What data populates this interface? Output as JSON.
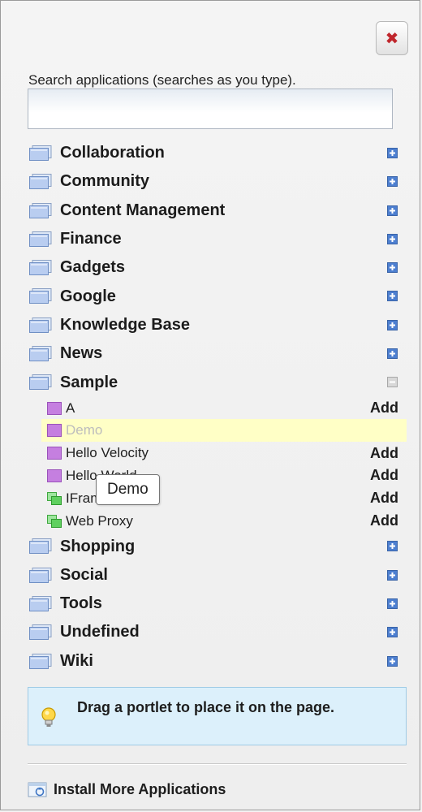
{
  "search": {
    "label": "Search applications (searches as you type).",
    "value": "",
    "placeholder": ""
  },
  "categories_top": [
    {
      "label": "Collaboration",
      "expanded": false
    },
    {
      "label": "Community",
      "expanded": false
    },
    {
      "label": "Content Management",
      "expanded": false
    },
    {
      "label": "Finance",
      "expanded": false
    },
    {
      "label": "Gadgets",
      "expanded": false
    },
    {
      "label": "Google",
      "expanded": false
    },
    {
      "label": "Knowledge Base",
      "expanded": false
    },
    {
      "label": "News",
      "expanded": false
    }
  ],
  "sample": {
    "label": "Sample",
    "expanded": true,
    "apps": [
      {
        "label": "A",
        "add": "Add",
        "icon": "portlet-icon-purple"
      },
      {
        "label": "Demo",
        "add": "",
        "icon": "portlet-icon-purple",
        "highlighted": true
      },
      {
        "label": "Hello Velocity",
        "add": "Add",
        "icon": "portlet-icon-purple"
      },
      {
        "label": "Hello World",
        "add": "Add",
        "icon": "portlet-icon-purple"
      },
      {
        "label": "IFrame",
        "add": "Add",
        "icon": "portlet-icon-green"
      },
      {
        "label": "Web Proxy",
        "add": "Add",
        "icon": "portlet-icon-green"
      }
    ]
  },
  "categories_bottom": [
    {
      "label": "Shopping",
      "expanded": false
    },
    {
      "label": "Social",
      "expanded": false
    },
    {
      "label": "Tools",
      "expanded": false
    },
    {
      "label": "Undefined",
      "expanded": false
    },
    {
      "label": "Wiki",
      "expanded": false
    }
  ],
  "tooltip": {
    "text": "Demo"
  },
  "tip": {
    "text": "Drag a portlet to place it on the page."
  },
  "install": {
    "label": "Install More Applications"
  },
  "colors": {
    "close_x": "#c0272d",
    "tip_bg": "#dcf0fb",
    "tip_border": "#9fcbe6",
    "highlight_bg": "#ffffc6",
    "plus_icon": "#4d7fd0",
    "purple_icon": "#c57fe0",
    "green_icon": "#5fd05f"
  }
}
